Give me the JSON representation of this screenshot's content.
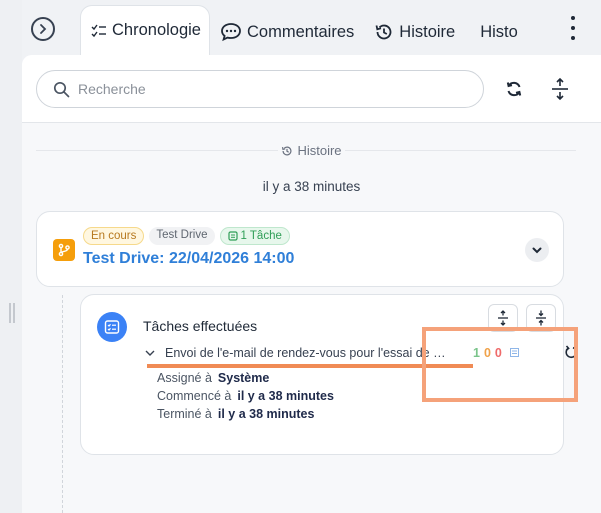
{
  "tabs": [
    {
      "label": "Chronologie",
      "icon": "checklist-icon",
      "active": true
    },
    {
      "label": "Commentaires",
      "icon": "chat-bubble-icon"
    },
    {
      "label": "Histoire",
      "icon": "history-icon"
    },
    {
      "label": "Histo",
      "icon": "history-icon"
    }
  ],
  "search": {
    "placeholder": "Recherche"
  },
  "timeline": {
    "section_label": "Histoire",
    "time_ago": "il y a 38 minutes"
  },
  "card": {
    "badges": {
      "status": "En cours",
      "type": "Test Drive",
      "tasks": "1 Tâche"
    },
    "title": "Test Drive: 22/04/2026 14:00"
  },
  "sub_card": {
    "title": "Tâches effectuées",
    "task": {
      "text": "Envoi de l'e-mail de rendez-vous pour l'essai de …",
      "counts": [
        "1",
        "0",
        "0"
      ]
    },
    "details": [
      {
        "label": "Assigné à",
        "value": "Système"
      },
      {
        "label": "Commencé à",
        "value": "il y a 38 minutes"
      },
      {
        "label": "Terminé à",
        "value": "il y a 38 minutes"
      }
    ]
  },
  "colors": {
    "accent_blue": "#2f7fd8",
    "status_orange": "#f59e0b",
    "annotation": "#f08b55"
  }
}
